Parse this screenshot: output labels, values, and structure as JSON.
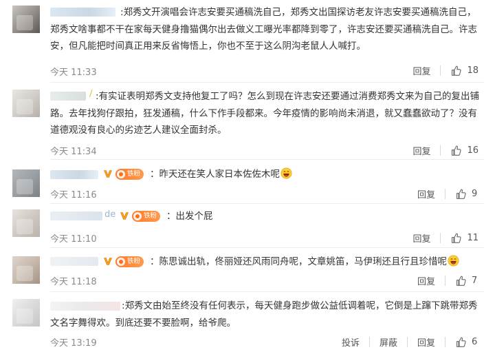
{
  "comments": [
    {
      "text": "郑秀文开演唱会许志安要买通稿洗自己，郑秀文出国探访老友许志安要买通稿洗自己，郑秀文啥事都不干在家每天健身撸猫偶尔出去做义工曝光率都降到零了，许志安还要买通稿洗自己。许志安，但凡能把时间真正用来反省悔悟上，你也不至于这么阴沟老鼠人人喊打。",
      "time": "今天 11:33",
      "reply_label": "回复",
      "likes": "18"
    },
    {
      "text": "有实证表明郑秀文支持他复工了吗？怎么到现在许志安还要通过消费郑秀文来为自己的复出铺路。去年找狗仔跟拍，狂发通稿，什么下作手段都来。今年疫情的影响尚未消退，就又蠢蠢欲动了？没有道德观没有良心的劣迹艺人建议全面封杀。",
      "time": "今天 11:34",
      "reply_label": "回复",
      "likes": "16"
    },
    {
      "text": "昨天还在笑人家日本佐佐木呢",
      "badge": "铁粉",
      "time": "今天 11:16",
      "reply_label": "回复",
      "likes": "9"
    },
    {
      "text": "出发个屁",
      "prefix": "de",
      "badge": "铁粉",
      "time": "今天 11:10",
      "reply_label": "回复",
      "likes": "11"
    },
    {
      "text": "陈思诚出轨，佟丽娅还风雨同舟呢，文章姚笛，马伊琍还且行且珍惜呢",
      "badge": "铁粉",
      "time": "今天 11:18",
      "reply_label": "回复",
      "likes": "7"
    },
    {
      "text": "郑秀文由始至终没有任何表示，每天健身跑步做公益低调着呢，它倒是上蹿下跳带郑秀文名字舞得欢。到底还要不要脸啊，给爷爬。",
      "time": "今天 13:19",
      "report_label": "投诉",
      "block_label": "屏蔽",
      "reply_label": "回复",
      "likes": "6"
    }
  ],
  "colors": {
    "text": "#333333",
    "meta": "#8a8a8a",
    "badge": "#ff7a2e",
    "vip": "#f7a51c",
    "divider": "#ececec"
  },
  "icons": {
    "like": "thumb-up-icon",
    "vip": "v-verified-icon",
    "fans": "fans-badge-icon",
    "laugh": "laugh-emoji-icon"
  }
}
